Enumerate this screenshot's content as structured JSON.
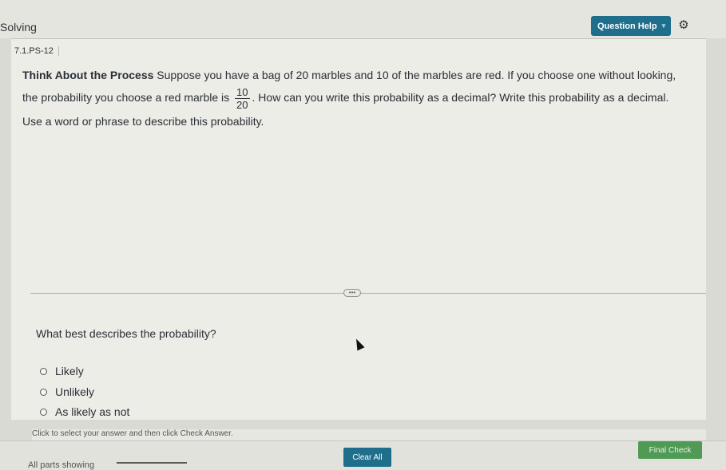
{
  "header": {
    "app_title": "Solving",
    "help_label": "Question Help",
    "help_arrow": "▾"
  },
  "question": {
    "id": "7.1.PS-12",
    "lead": "Think About the Process",
    "text_part1": " Suppose you have a bag of 20 marbles and 10 of the marbles are red. If you choose one without looking, the probability you choose a red marble is ",
    "fraction": {
      "numerator": "10",
      "denominator": "20"
    },
    "text_part2": ". How can you write this probability as a decimal? Write this probability as a decimal. Use a word or phrase to describe this probability.",
    "divider_handle": "•••",
    "prompt": "What best describes the probability?",
    "options": [
      {
        "label": "Likely"
      },
      {
        "label": "Unlikely"
      },
      {
        "label": "As likely as not"
      }
    ]
  },
  "footer": {
    "instruction": "Click to select your answer and then click Check Answer.",
    "parts_showing": "All parts showing",
    "clear_all": "Clear All",
    "final_check": "Final Check"
  },
  "icons": {
    "settings": "gear-icon",
    "cursor": "mouse-cursor-icon"
  },
  "colors": {
    "accent": "#1f6e8c",
    "final_check": "#4f9a55"
  }
}
